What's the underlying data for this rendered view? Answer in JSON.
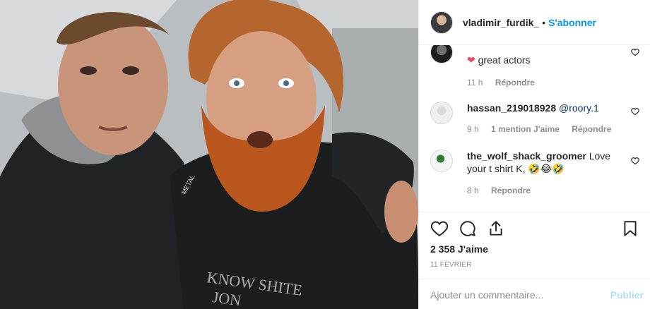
{
  "post": {
    "author": "vladimir_furdik_",
    "separator": "•",
    "follow_label": "S'abonner",
    "photo_shirt_text_1": "KNOW SHITE",
    "photo_shirt_text_2": "JON",
    "photo_hoodie_text": "METAL"
  },
  "comments": [
    {
      "text": "great actors",
      "time": "11 h",
      "reply": "Répondre"
    },
    {
      "name": "hassan_219018928",
      "mention": "@roory.1",
      "time": "9 h",
      "likes": "1 mention J'aime",
      "reply": "Répondre"
    },
    {
      "name": "the_wolf_shack_groomer",
      "text": "Love your t shirt K, 🤣😂🤣",
      "time": "8 h",
      "reply": "Répondre"
    }
  ],
  "actions": {
    "likes_count": "2 358 J'aime",
    "date": "11 FÉVRIER",
    "comment_placeholder": "Ajouter un commentaire...",
    "publish_label": "Publier"
  },
  "colors": {
    "accent": "#0095f6",
    "heart": "#ed4956",
    "muted": "#8e8e8e"
  },
  "icons": [
    "heart-icon",
    "comment-icon",
    "share-icon",
    "bookmark-icon",
    "heart-outline-icon"
  ]
}
